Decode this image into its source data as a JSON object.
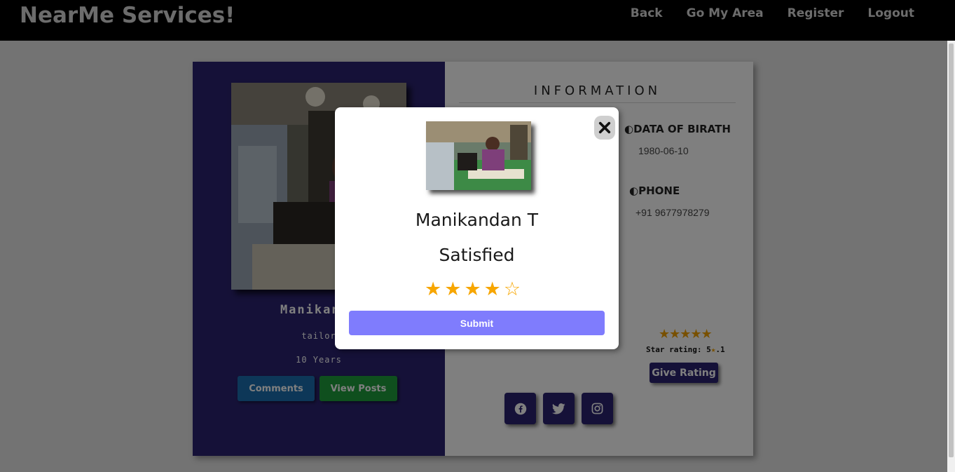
{
  "navbar": {
    "brand": "NearMe Services!",
    "links": [
      "Back",
      "Go My Area",
      "Register",
      "Logout"
    ]
  },
  "profile": {
    "name": "Manikandan T",
    "name_visible": "Manikanda",
    "job": "tailor",
    "experience": "10 Years",
    "comments_label": "Comments",
    "posts_label": "View Posts"
  },
  "info": {
    "title": "INFORMATION",
    "dob_label": "◐DATA OF BIRATH",
    "dob_value": "1980-06-10",
    "phone_label": "◐PHONE",
    "phone_value": "+91 9677978279",
    "stars_display": "★★★★★",
    "rating_text_prefix": "Star rating: 5",
    "rating_star_glyph": "★",
    "rating_text_suffix": ".1",
    "give_rating_label": "Give Rating"
  },
  "social": {
    "icons": [
      "facebook-icon",
      "twitter-icon",
      "instagram-icon"
    ]
  },
  "modal": {
    "name": "Manikandan T",
    "status": "Satisfied",
    "rating": 4,
    "max_rating": 5,
    "submit_label": "Submit",
    "close_icon": "close-icon"
  },
  "colors": {
    "navbar_bg": "#000000",
    "panel_left": "#2b2370",
    "comments_btn": "#1b6fb1",
    "posts_btn": "#1e9e3c",
    "star": "#f7a600",
    "submit_btn": "#7f7cfd"
  }
}
